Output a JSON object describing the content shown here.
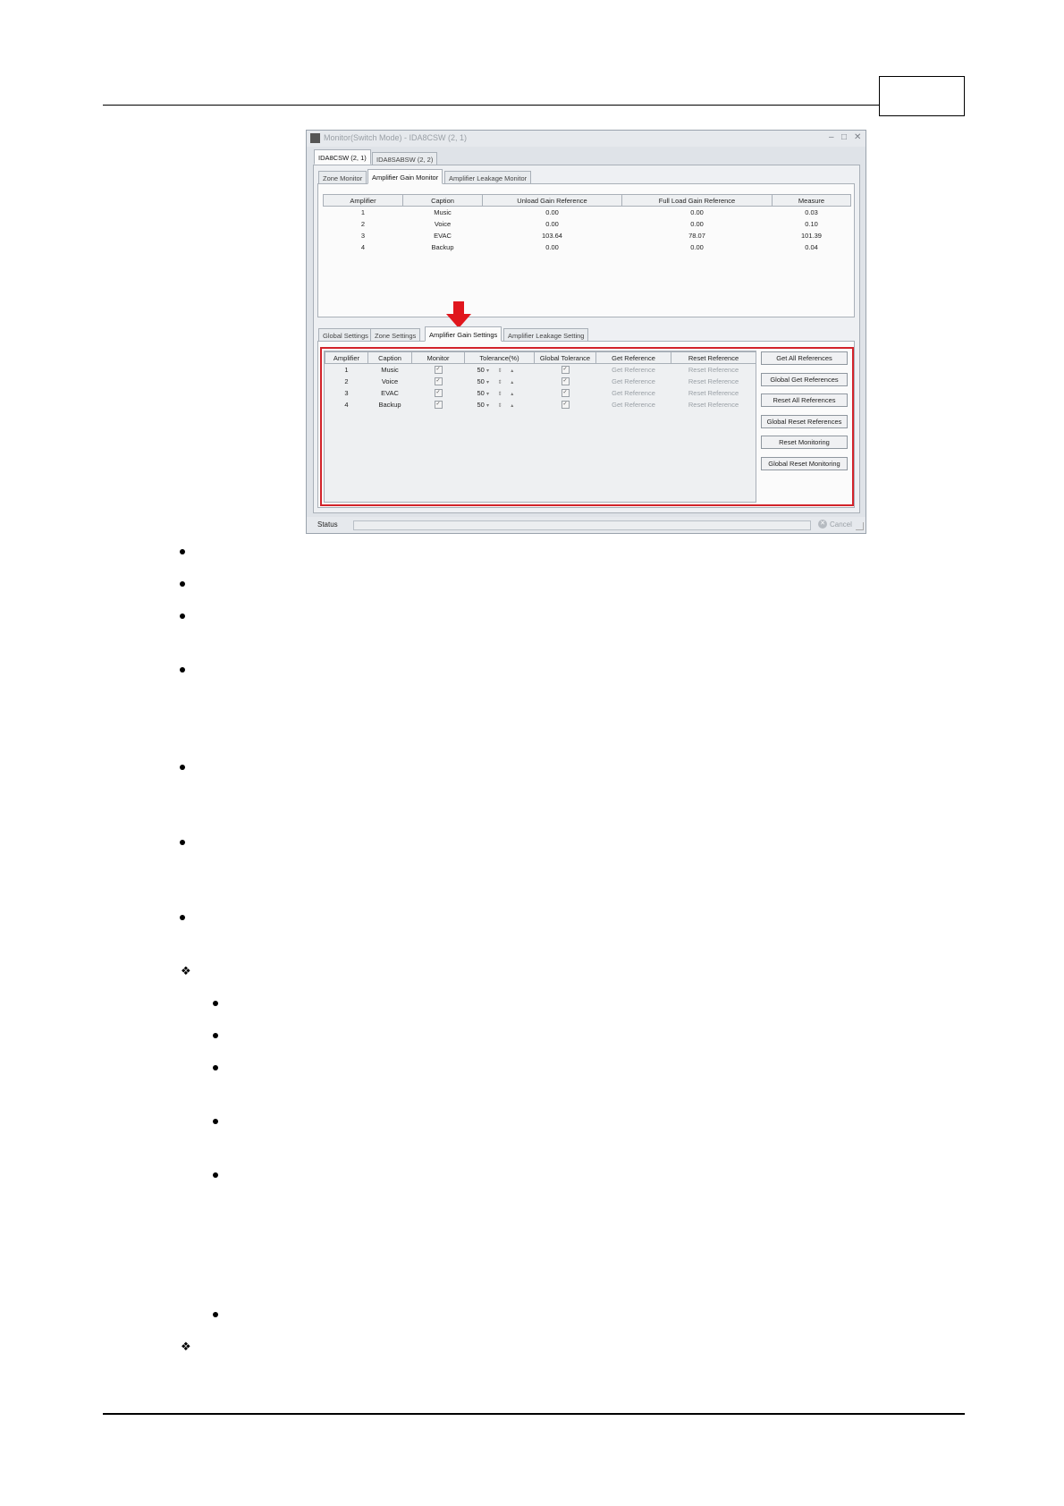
{
  "window": {
    "title": "Monitor(Switch Mode) - IDA8CSW (2, 1)",
    "controls": [
      "–",
      "□",
      "✕"
    ]
  },
  "device_tabs": [
    "IDA8CSW (2, 1)",
    "IDA8SABSW (2, 2)"
  ],
  "monitor_tabs": [
    "Zone Monitor",
    "Amplifier Gain Monitor",
    "Amplifier Leakage Monitor"
  ],
  "gain_monitor": {
    "columns": [
      "Amplifier",
      "Caption",
      "Unload Gain Reference",
      "Full Load Gain Reference",
      "Measure"
    ],
    "rows": [
      [
        "1",
        "Music",
        "0.00",
        "0.00",
        "0.03"
      ],
      [
        "2",
        "Voice",
        "0.00",
        "0.00",
        "0.10"
      ],
      [
        "3",
        "EVAC",
        "103.64",
        "78.07",
        "101.39"
      ],
      [
        "4",
        "Backup",
        "0.00",
        "0.00",
        "0.04"
      ]
    ]
  },
  "settings_tabs": [
    "Global Settings",
    "Zone Settings",
    "Amplifier Gain Settings",
    "Amplifier Leakage Setting"
  ],
  "gain_settings": {
    "columns": [
      "Amplifier",
      "Caption",
      "Monitor",
      "Tolerance(%)",
      "Global Tolerance",
      "Get Reference",
      "Reset Reference"
    ],
    "rows": [
      {
        "amp": "1",
        "caption": "Music",
        "tolerance": "50",
        "get": "Get Reference",
        "reset": "Reset Reference"
      },
      {
        "amp": "2",
        "caption": "Voice",
        "tolerance": "50",
        "get": "Get Reference",
        "reset": "Reset Reference"
      },
      {
        "amp": "3",
        "caption": "EVAC",
        "tolerance": "50",
        "get": "Get Reference",
        "reset": "Reset Reference"
      },
      {
        "amp": "4",
        "caption": "Backup",
        "tolerance": "50",
        "get": "Get Reference",
        "reset": "Reset Reference"
      }
    ]
  },
  "buttons": [
    "Get All References",
    "Global Get References",
    "Reset All References",
    "Global Reset References",
    "Reset Monitoring",
    "Global Reset Monitoring"
  ],
  "status": {
    "label": "Status",
    "cancel": "Cancel"
  },
  "colors": {
    "highlight": "#d2232a",
    "arrow": "#e0161d"
  }
}
